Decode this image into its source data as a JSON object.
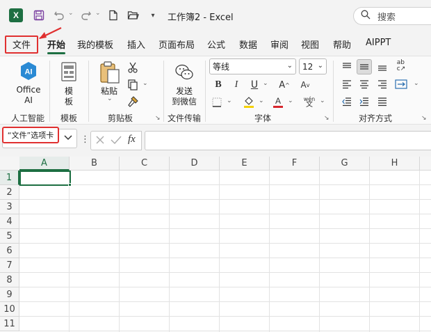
{
  "title_bar": {
    "app_icon_letter": "X",
    "document_title": "工作簿2 - Excel",
    "search_placeholder": "搜索"
  },
  "tabs": [
    {
      "label": "文件",
      "active": false,
      "highlighted": true
    },
    {
      "label": "开始",
      "active": true
    },
    {
      "label": "我的模板",
      "active": false
    },
    {
      "label": "插入",
      "active": false
    },
    {
      "label": "页面布局",
      "active": false
    },
    {
      "label": "公式",
      "active": false
    },
    {
      "label": "数据",
      "active": false
    },
    {
      "label": "审阅",
      "active": false
    },
    {
      "label": "视图",
      "active": false
    },
    {
      "label": "帮助",
      "active": false
    },
    {
      "label": "AIPPT",
      "active": false
    }
  ],
  "ribbon": {
    "office_ai": {
      "label_line1": "Office",
      "label_line2": "AI",
      "icon_text": "AI",
      "group": "人工智能"
    },
    "template": {
      "label_line1": "模",
      "label_line2": "板",
      "group": "模板"
    },
    "clipboard": {
      "paste_label": "粘贴",
      "group": "剪贴板"
    },
    "transfer": {
      "label_line1": "发送",
      "label_line2": "到微信",
      "group": "文件传输"
    },
    "font": {
      "font_name": "等线",
      "font_size": "12",
      "group": "字体",
      "bold": "B",
      "italic": "I",
      "underline": "U",
      "phonetic": "wén"
    },
    "alignment": {
      "group": "对齐方式"
    }
  },
  "formula_bar": {
    "callout_text": "“文件”选项卡",
    "fx_label": "fx",
    "formula_value": ""
  },
  "grid": {
    "columns": [
      "A",
      "B",
      "C",
      "D",
      "E",
      "F",
      "G",
      "H"
    ],
    "rows": [
      "1",
      "2",
      "3",
      "4",
      "5",
      "6",
      "7",
      "8",
      "9",
      "10",
      "11"
    ],
    "active_cell": "A1"
  },
  "colors": {
    "excel_green": "#1d6f42",
    "annotation_red": "#e03030"
  }
}
